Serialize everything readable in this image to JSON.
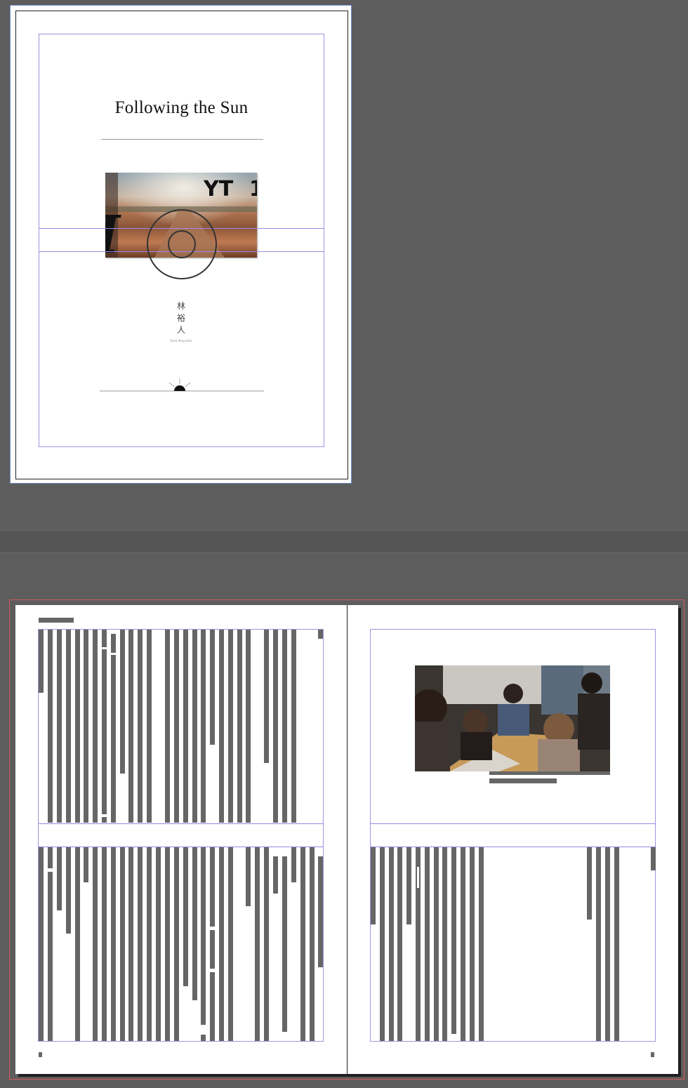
{
  "cover": {
    "title": "Following the Sun",
    "author_name_jp": "林 裕 人",
    "author_name_romaji": "Yuto Hayashi",
    "image_icon": "road-photo-with-vinyl-lettering",
    "rule_icon": "rising-sun-icon"
  },
  "spread": {
    "left_page_header": "running-header-placeholder",
    "right_page_image_icon": "group-puzzle-photo",
    "caption": "caption-placeholder"
  },
  "colors": {
    "pasteboard": "#5d5d5d",
    "page": "#ffffff",
    "margin_guide": "#a990e0",
    "bleed_guide": "#d45a5a",
    "selection": "#6f8fcf",
    "greeked_text": "#666666"
  }
}
